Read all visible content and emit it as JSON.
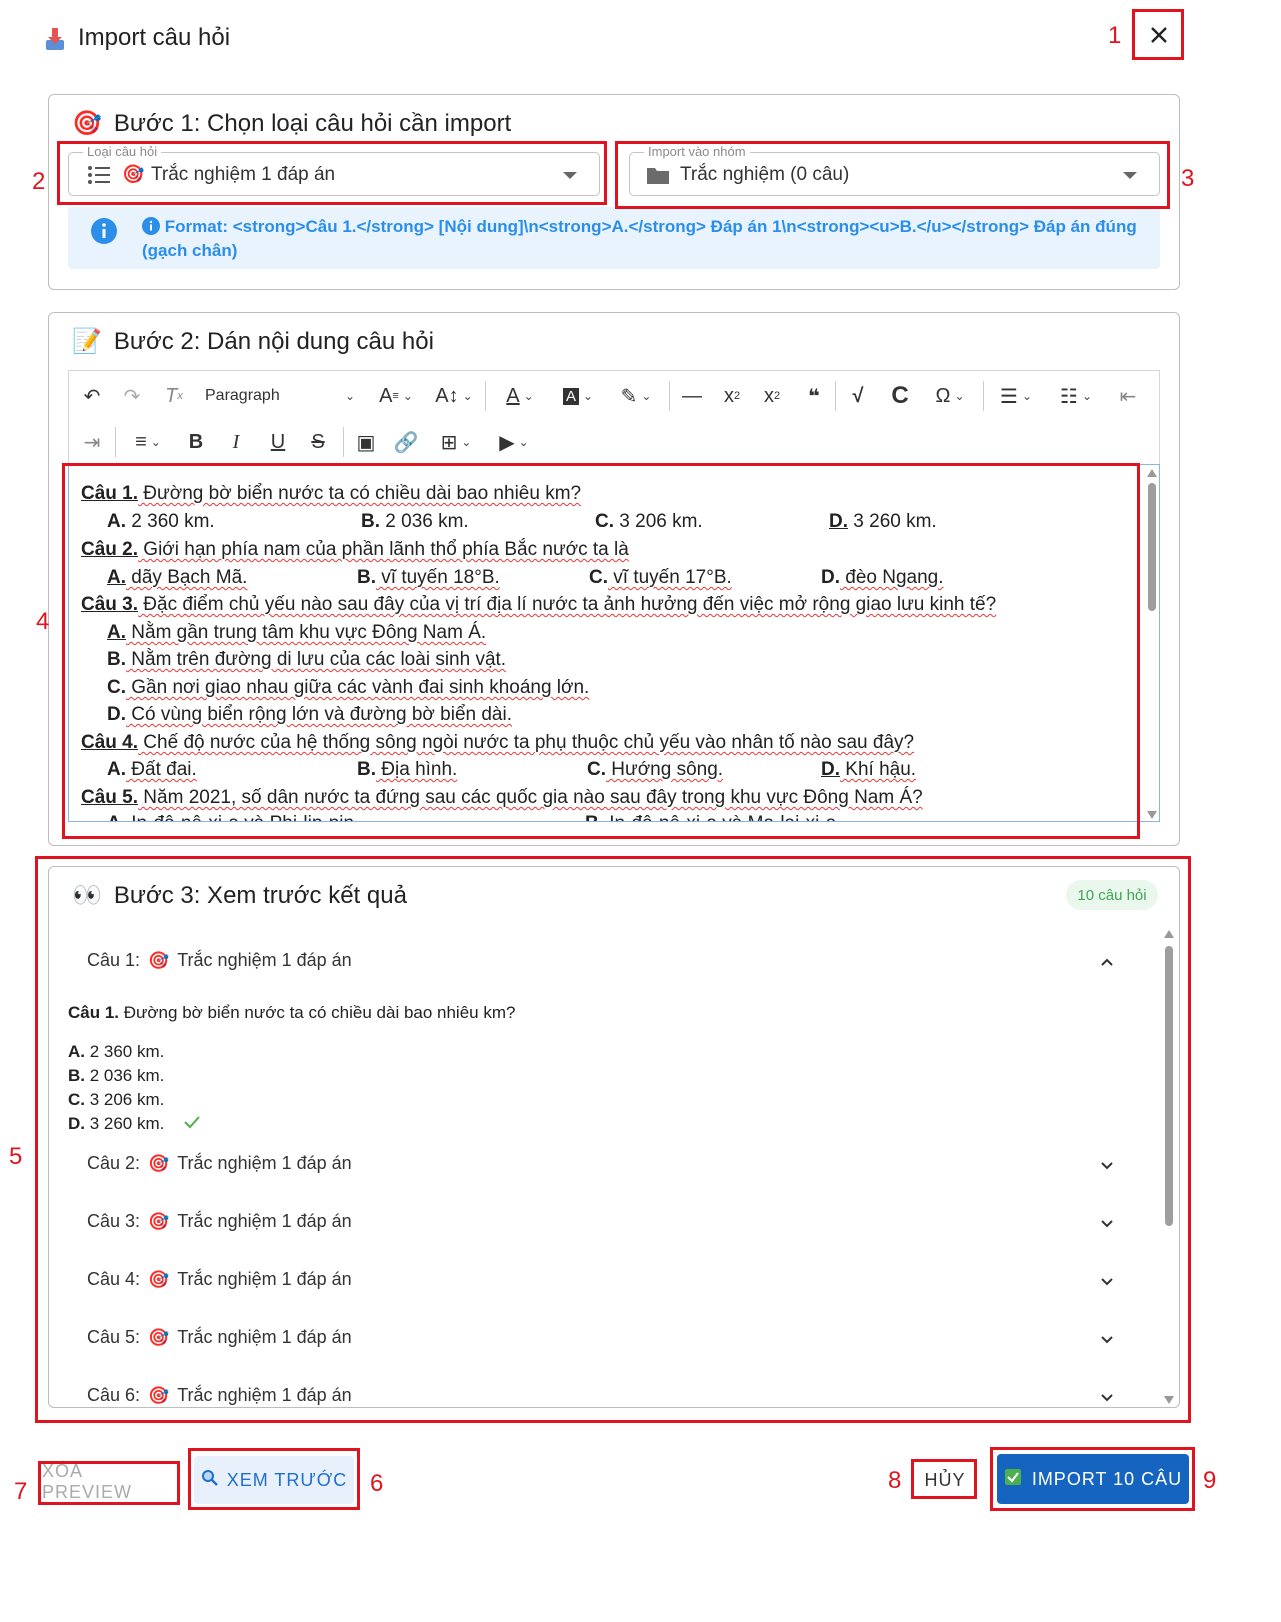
{
  "dialog": {
    "title": "Import câu hỏi"
  },
  "annotations": [
    "1",
    "2",
    "3",
    "4",
    "5",
    "6",
    "7",
    "8",
    "9"
  ],
  "step1": {
    "title": "Bước 1: Chọn loại câu hỏi cần import",
    "type_select": {
      "label": "Loại câu hỏi",
      "value": "Trắc nghiệm 1 đáp án"
    },
    "group_select": {
      "label": "Import vào nhóm",
      "value": "Trắc nghiệm (0 câu)"
    },
    "info_format": "Format: <strong>Câu 1.</strong> [Nội dung]\\n<strong>A.</strong> Đáp án 1\\n<strong><u>B.</u></strong> Đáp án đúng (gạch chân)"
  },
  "step2": {
    "title": "Bước 2: Dán nội dung câu hỏi",
    "toolbar": {
      "paragraph_label": "Paragraph"
    },
    "content": {
      "q1": {
        "num": "Câu 1.",
        "text": " Đường bờ biển nước ta có chiều dài bao nhiêu km?",
        "a": [
          "A.",
          " 2 360 km."
        ],
        "b": [
          "B.",
          " 2 036 km."
        ],
        "c": [
          "C.",
          " 3 206 km."
        ],
        "d": [
          "D.",
          " 3 260 km."
        ]
      },
      "q2": {
        "num": "Câu 2.",
        "text": " Giới hạn phía nam của phần lãnh thổ phía Bắc nước ta là",
        "a": [
          "A.",
          " dãy Bạch Mã."
        ],
        "b": [
          "B.",
          " vĩ tuyến 18°B."
        ],
        "c": [
          "C.",
          " vĩ tuyến 17°B."
        ],
        "d": [
          "D.",
          " đèo Ngang."
        ]
      },
      "q3": {
        "num": "Câu 3.",
        "text": " Đặc điểm chủ yếu nào sau đây của vị trí địa lí nước ta ảnh hưởng đến việc mở rộng giao lưu kinh tế?",
        "a": [
          "A.",
          " Nằm gần trung tâm khu vực Đông Nam Á."
        ],
        "b": [
          "B.",
          " Nằm trên đường di lưu của các loài sinh vật."
        ],
        "c": [
          "C.",
          " Gần nơi giao nhau giữa các vành đai sinh khoáng lớn."
        ],
        "d": [
          "D.",
          " Có vùng biển rộng lớn và đường bờ biển dài."
        ]
      },
      "q4": {
        "num": "Câu 4.",
        "text": " Chế độ nước của hệ thống sông ngòi nước ta phụ thuộc chủ yếu vào nhân tố nào sau đây?",
        "a": [
          "A.",
          " Đất đai."
        ],
        "b": [
          "B.",
          " Địa hình."
        ],
        "c": [
          "C.",
          " Hướng sông."
        ],
        "d": [
          "D.",
          " Khí hậu."
        ]
      },
      "q5": {
        "num": "Câu 5.",
        "text": " Năm 2021, số dân nước ta đứng sau các quốc gia nào sau đây trong khu vực Đông Nam Á?",
        "a": [
          "A.",
          " In-đô-nê-xi-a và Phi-lip-pin."
        ],
        "b": [
          "B.",
          " In-đô-nê-xi-a và Ma-lai-xi-a."
        ]
      }
    }
  },
  "step3": {
    "title": "Bước 3: Xem trước kết quả",
    "count_badge": "10 câu hỏi",
    "type_label": "Trắc nghiệm 1 đáp án",
    "items": [
      "Câu 1:",
      "Câu 2:",
      "Câu 3:",
      "Câu 4:",
      "Câu 5:",
      "Câu 6:"
    ],
    "expanded": {
      "question_num": "Câu 1.",
      "question_text": " Đường bờ biển nước ta có chiều dài bao nhiêu km?",
      "options": [
        {
          "key": "A.",
          "text": " 2 360 km."
        },
        {
          "key": "B.",
          "text": " 2 036 km."
        },
        {
          "key": "C.",
          "text": " 3 206 km."
        },
        {
          "key": "D.",
          "text": " 3 260 km.",
          "correct": true
        }
      ]
    }
  },
  "actions": {
    "clear_preview": "XÓA PREVIEW",
    "preview": "XEM TRƯỚC",
    "cancel": "HỦY",
    "import": "IMPORT 10 CÂU"
  },
  "colors": {
    "primary": "#1565c0",
    "info": "#2b8ee8",
    "annotation": "#e0141e",
    "badge_green": "#3ea552"
  }
}
